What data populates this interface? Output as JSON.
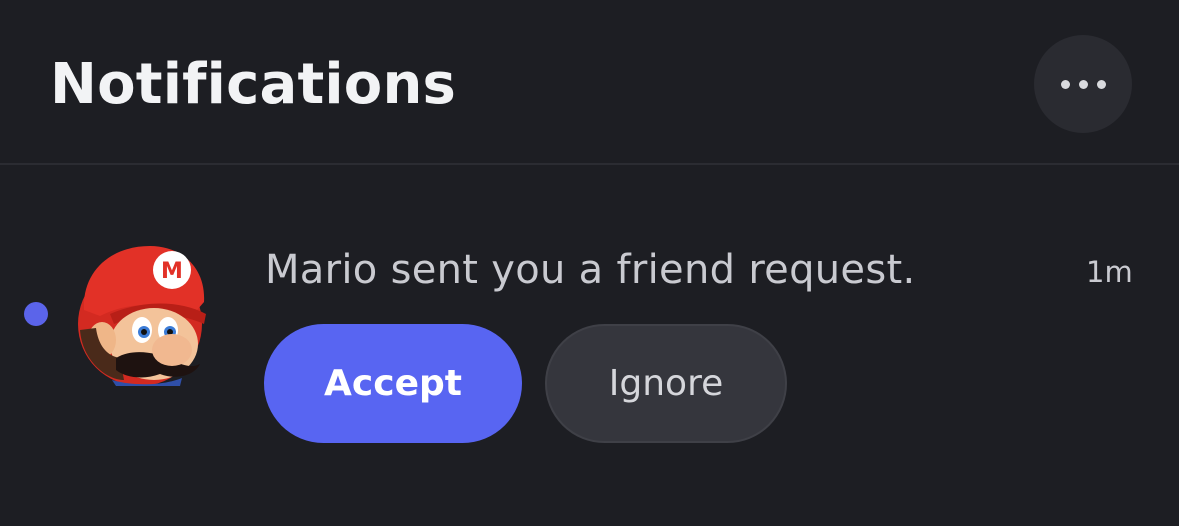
{
  "header": {
    "title": "Notifications",
    "more_icon": "more-horizontal-icon"
  },
  "notifications": [
    {
      "unread": true,
      "avatar": "mario-avatar",
      "message": "Mario sent you a friend request.",
      "time": "1m",
      "accept_label": "Accept",
      "ignore_label": "Ignore"
    }
  ],
  "colors": {
    "background": "#1d1e23",
    "accent": "#5865f2",
    "unread_dot": "#5b64ea",
    "secondary_button": "#35363d"
  }
}
